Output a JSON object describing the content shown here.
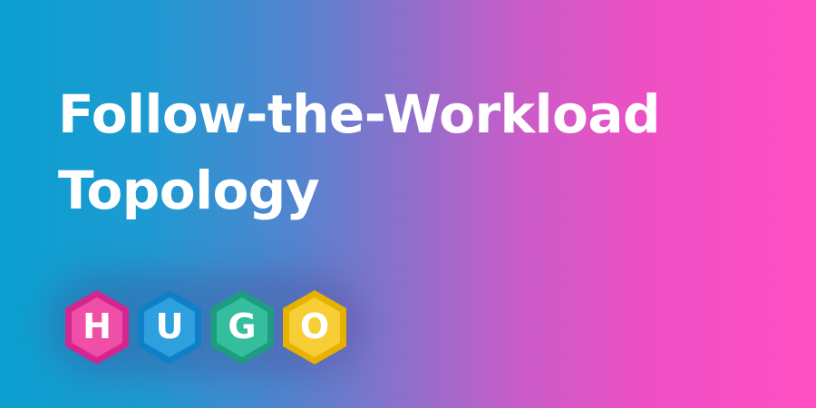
{
  "banner": {
    "title_line_1": "Follow-the-Workload",
    "title_line_2": "Topology"
  },
  "logo": {
    "letters": [
      "H",
      "U",
      "G",
      "O"
    ],
    "colors": {
      "h_outer": "#d4268f",
      "h_inner": "#f04fa7",
      "u_outer": "#0f80c7",
      "u_inner": "#2ea0de",
      "g_outer": "#1d9c82",
      "g_inner": "#34be9d",
      "o_outer": "#e7b100",
      "o_inner": "#f7ce35",
      "o_ring": "#e8b54b",
      "letter": "#ffffff"
    }
  },
  "colors": {
    "gradient_left": "#0b9fcf",
    "gradient_mid": "#8f6fcb",
    "gradient_right": "#ff4fc3",
    "text": "#ffffff"
  }
}
